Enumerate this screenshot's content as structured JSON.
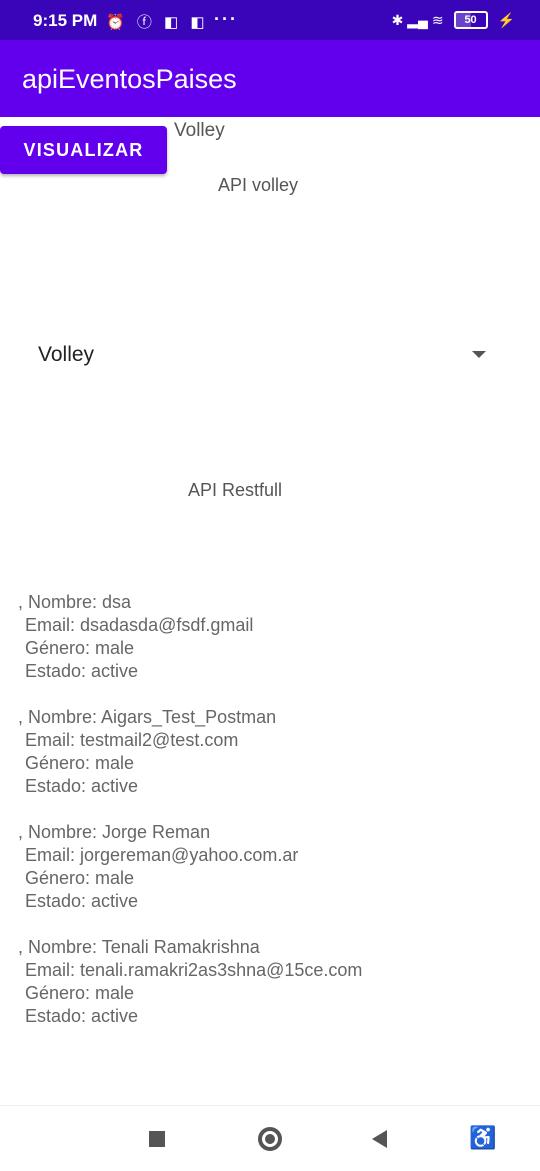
{
  "status_bar": {
    "time": "9:15 PM",
    "left_icons": "⏰ ⓕ ◧ ◧",
    "more": "···",
    "right_icons": "✱ ▂▄ ≋",
    "battery": "50",
    "charging": "⚡"
  },
  "app_bar": {
    "title": "apiEventosPaises"
  },
  "top_text": "Volley",
  "visualizar_label": "VISUALIZAR",
  "api_volley_label": "API volley",
  "spinner": {
    "value": "Volley"
  },
  "api_restfull_label": "API Restfull",
  "users": [
    {
      "nombre": ", Nombre: dsa",
      "email": "Email: dsadasda@fsdf.gmail",
      "genero": "Género: male",
      "estado": "Estado: active"
    },
    {
      "nombre": ", Nombre: Aigars_Test_Postman",
      "email": "Email: testmail2@test.com",
      "genero": "Género: male",
      "estado": "Estado: active"
    },
    {
      "nombre": ", Nombre: Jorge Reman",
      "email": "Email: jorgereman@yahoo.com.ar",
      "genero": "Género: male",
      "estado": "Estado: active"
    },
    {
      "nombre": ", Nombre: Tenali Ramakrishna",
      "email": "Email: tenali.ramakri2as3shna@15ce.com",
      "genero": "Género: male",
      "estado": "Estado: active"
    }
  ],
  "nav_icons": {
    "recents": "stop-icon",
    "home": "home-circle-icon",
    "back": "back-triangle-icon",
    "accessibility": "accessibility-icon"
  },
  "nav_glyphs": {
    "accessibility": "♿"
  }
}
